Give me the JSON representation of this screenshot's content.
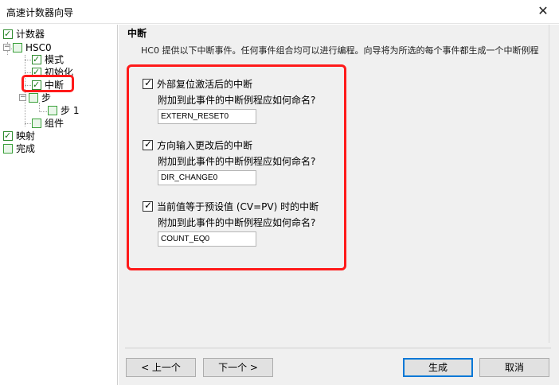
{
  "window": {
    "title": "高速计数器向导",
    "close_glyph": "✕"
  },
  "tree": {
    "items": [
      {
        "label": "计数器"
      },
      {
        "label": "HSC0"
      },
      {
        "label": "模式"
      },
      {
        "label": "初始化"
      },
      {
        "label": "中断"
      },
      {
        "label": "步"
      },
      {
        "label": "步 1"
      },
      {
        "label": "组件"
      },
      {
        "label": "映射"
      },
      {
        "label": "完成"
      }
    ]
  },
  "panel": {
    "heading": "中断",
    "description": "HC0 提供以下中断事件。任何事件组合均可以进行编程。向导将为所选的每个事件都生成一个中断例程",
    "events": [
      {
        "label": "外部复位激活后的中断",
        "question": "附加到此事件的中断例程应如何命名?",
        "value": "EXTERN_RESET0",
        "checked": true
      },
      {
        "label": "方向输入更改后的中断",
        "question": "附加到此事件的中断例程应如何命名?",
        "value": "DIR_CHANGE0",
        "checked": true
      },
      {
        "label": "当前值等于预设值 (CV=PV) 时的中断",
        "question": "附加到此事件的中断例程应如何命名?",
        "value": "COUNT_EQ0",
        "checked": true
      }
    ]
  },
  "buttons": {
    "prev": "< 上一个",
    "next": "下一个 >",
    "generate": "生成",
    "cancel": "取消"
  },
  "colors": {
    "highlight": "#ff1a1a",
    "tree_check": "#2e8b2e"
  }
}
